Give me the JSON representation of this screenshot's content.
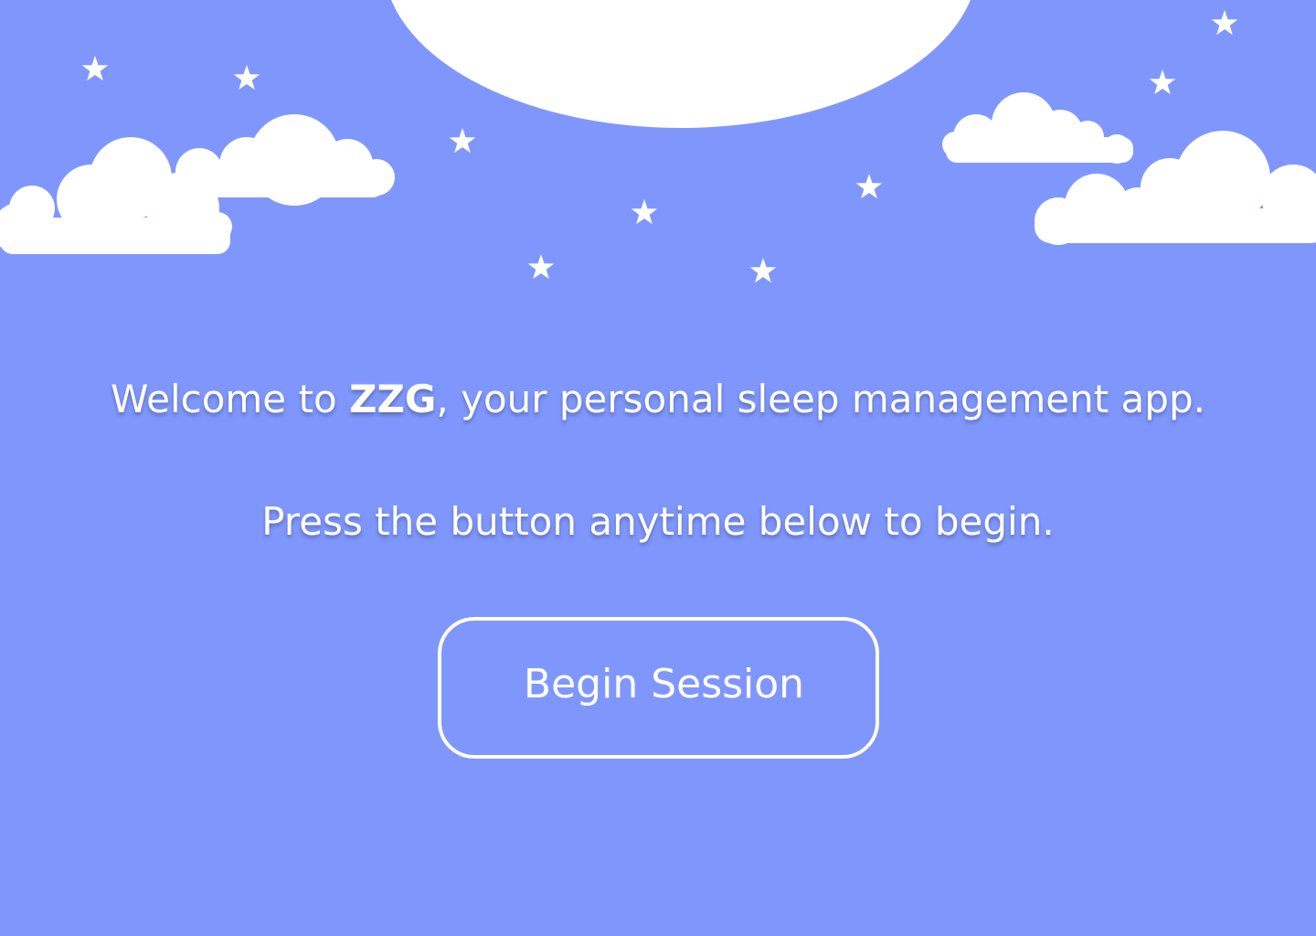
{
  "welcome": {
    "prefix": "Welcome to ",
    "app_name": "ZZG",
    "suffix": ", your personal sleep management app."
  },
  "instruction": "Press the button anytime below to begin.",
  "button": {
    "label": "Begin Session"
  },
  "colors": {
    "background": "#7f97fd",
    "foreground": "#ffffff"
  },
  "decor": {
    "moon_icon": "moon-icon",
    "cloud_icon": "cloud-icon",
    "star_icon": "star-icon"
  }
}
